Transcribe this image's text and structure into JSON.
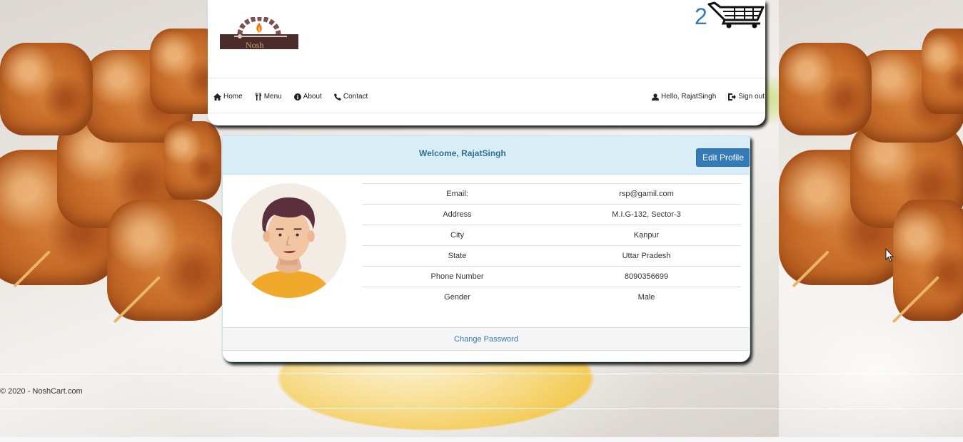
{
  "brand": {
    "logo_text": "Nosh"
  },
  "cart": {
    "count": "2",
    "icon": "shopping-cart-icon"
  },
  "nav": {
    "left": [
      {
        "label": "Home",
        "icon": "home-icon"
      },
      {
        "label": "Menu",
        "icon": "cutlery-icon"
      },
      {
        "label": "About",
        "icon": "info-icon"
      },
      {
        "label": "Contact",
        "icon": "phone-icon"
      }
    ],
    "right": [
      {
        "label": "Hello, RajatSingh",
        "icon": "user-icon"
      },
      {
        "label": "Sign out",
        "icon": "sign-out-icon"
      }
    ]
  },
  "profile": {
    "welcome": "Welcome, RajatSingh",
    "edit_label": "Edit Profile",
    "rows": [
      {
        "label": "Email:",
        "value": "rsp@gamil.com"
      },
      {
        "label": "Address",
        "value": "M.I.G-132, Sector-3"
      },
      {
        "label": "City",
        "value": "Kanpur"
      },
      {
        "label": "State",
        "value": "Uttar Pradesh"
      },
      {
        "label": "Phone Number",
        "value": "8090356699"
      },
      {
        "label": "Gender",
        "value": "Male"
      }
    ],
    "change_password": "Change Password"
  },
  "footer": {
    "copyright": "© 2020 - NoshCart.com"
  },
  "colors": {
    "link": "#337ab7",
    "panel_heading": "#d9edf7",
    "heading_text": "#31708f"
  }
}
